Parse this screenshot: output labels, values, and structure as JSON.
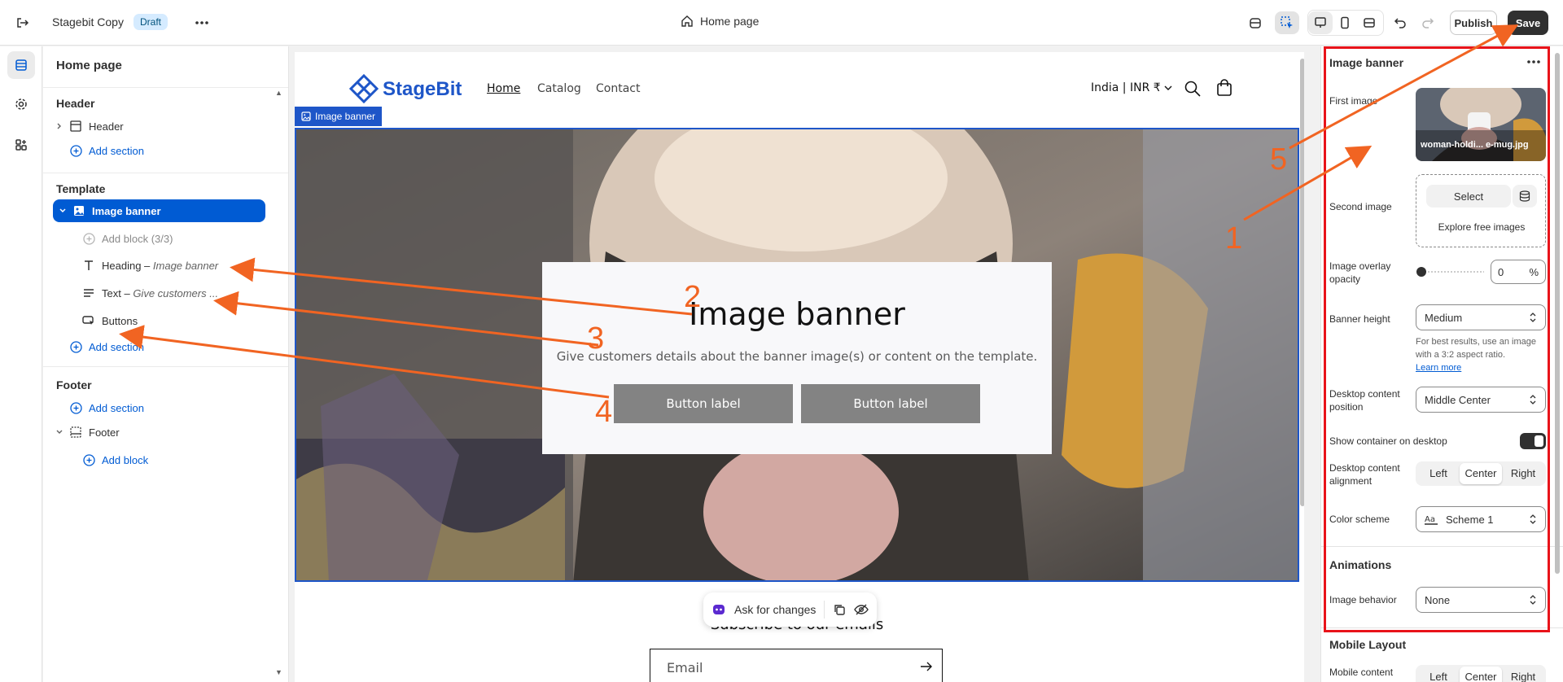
{
  "topbar": {
    "store_name": "Stagebit Copy",
    "status_badge": "Draft",
    "current_page": "Home page",
    "publish_label": "Publish",
    "save_label": "Save"
  },
  "left_panel": {
    "title": "Home page",
    "header_group": "Header",
    "header_item": "Header",
    "add_section": "Add section",
    "template_group": "Template",
    "selected_section": "Image banner",
    "add_block_disabled": "Add block (3/3)",
    "blocks": [
      {
        "name": "Heading",
        "detail": "Image banner"
      },
      {
        "name": "Text",
        "detail": "Give customers ..."
      },
      {
        "name": "Buttons",
        "detail": ""
      }
    ],
    "footer_group": "Footer",
    "footer_item": "Footer",
    "add_block": "Add block"
  },
  "preview": {
    "brand": "StageBit",
    "nav": [
      "Home",
      "Catalog",
      "Contact"
    ],
    "currency": "India | INR ₹",
    "section_tag": "Image banner",
    "banner_heading": "Image banner",
    "banner_text": "Give customers details about the banner image(s) or content on the template.",
    "button_1": "Button label",
    "button_2": "Button label",
    "subscribe": "Subscribe to our emails",
    "email_placeholder": "Email",
    "ask_label": "Ask for changes"
  },
  "settings": {
    "title": "Image banner",
    "first_image_label": "First image",
    "first_image_file": "woman-holdi... e-mug.jpg",
    "second_image_label": "Second image",
    "select_label": "Select",
    "explore_label": "Explore free images",
    "overlay_label": "Image overlay opacity",
    "overlay_value": "0",
    "overlay_unit": "%",
    "banner_height_label": "Banner height",
    "banner_height_value": "Medium",
    "help_text": "For best results, use an image with a 3:2 aspect ratio.",
    "help_link": "Learn more",
    "desktop_position_label": "Desktop content position",
    "desktop_position_value": "Middle Center",
    "show_container_label": "Show container on desktop",
    "show_container_on": true,
    "alignment_label": "Desktop content alignment",
    "alignment_options": [
      "Left",
      "Center",
      "Right"
    ],
    "alignment_selected": "Center",
    "color_scheme_label": "Color scheme",
    "color_scheme_value": "Scheme 1",
    "animations_heading": "Animations",
    "image_behavior_label": "Image behavior",
    "image_behavior_value": "None",
    "mobile_heading": "Mobile Layout",
    "mobile_alignment_label": "Mobile content",
    "mobile_alignment_options": [
      "Left",
      "Center",
      "Right"
    ],
    "mobile_alignment_selected": "Center"
  },
  "annotations": {
    "numbers": [
      "1",
      "2",
      "3",
      "4",
      "5"
    ],
    "arrow_color": "#f16422",
    "highlight_color": "#e8131a"
  },
  "colors": {
    "accent": "#005bd3",
    "preview_accent": "#1e56c8",
    "primary_button": "#303030"
  }
}
